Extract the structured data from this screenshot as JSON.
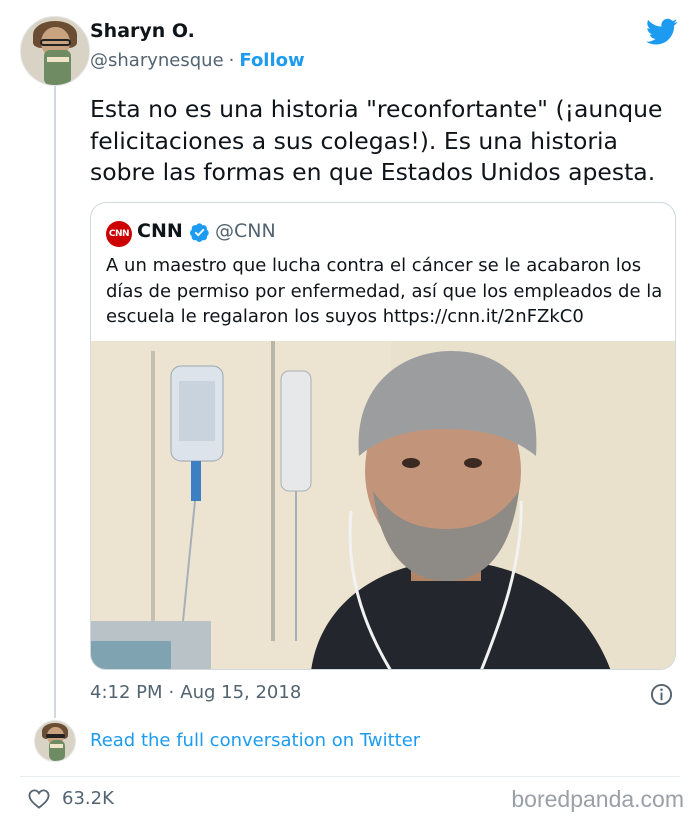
{
  "author": {
    "name": "Sharyn O.",
    "handle": "@sharynesque",
    "separator": "·",
    "follow_label": "Follow"
  },
  "tweet": {
    "text": "Esta no es una historia \"reconfortante\" (¡aunque felicitaciones a sus colegas!). Es una historia sobre las formas en que Estados Unidos apesta."
  },
  "quoted": {
    "logo_text": "CNN",
    "name": "CNN",
    "handle": "@CNN",
    "text": "A un maestro que lucha contra el cáncer se le acabaron los días de permiso por enfermedad, así que los empleados de la escuela le regalaron los suyos https://cnn.it/2nFZkC0"
  },
  "meta": {
    "time": "4:12 PM",
    "separator": "·",
    "date": "Aug 15, 2018"
  },
  "conversation": {
    "link_text": "Read the full conversation on Twitter"
  },
  "engagement": {
    "likes": "63.2K"
  },
  "watermark": "boredpanda.com",
  "icons": {
    "brand": "twitter-bird-icon",
    "verified": "verified-badge-icon",
    "info": "info-icon",
    "like": "heart-icon"
  },
  "colors": {
    "accent": "#1d9bf0",
    "text": "#0f1419",
    "muted": "#536471",
    "border": "#cfd9de",
    "cnn_red": "#cc0000"
  }
}
